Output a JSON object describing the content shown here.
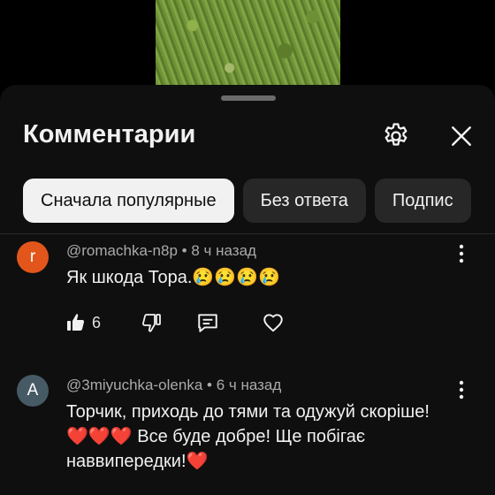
{
  "header": {
    "title": "Комментарии",
    "icons": {
      "settings": "gear-icon",
      "close": "close-icon"
    }
  },
  "filters": [
    {
      "label": "Сначала популярные",
      "active": true
    },
    {
      "label": "Без ответа",
      "active": false
    },
    {
      "label": "Подпис",
      "active": false
    }
  ],
  "comments": [
    {
      "avatar_letter": "r",
      "avatar_color": "#e2561c",
      "author": "@romachka-n8p",
      "time": "8 ч назад",
      "text": "Як шкода Тора.😢😢😢😢",
      "likes": "6"
    },
    {
      "avatar_letter": "A",
      "avatar_color": "#455a64",
      "author": "@3miyuchka-olenka",
      "time": "6 ч назад",
      "text": "Торчик, приходь до тями та одужуй скоріше! ❤️❤️❤️ Все буде добре! Ще побігає наввипередки!❤️"
    }
  ],
  "colors": {
    "sheet_bg": "#0f0f0f",
    "chip_bg": "#272727",
    "chip_active_bg": "#f1f1f1",
    "text": "#f1f1f1",
    "meta_text": "#aaaaaa"
  }
}
